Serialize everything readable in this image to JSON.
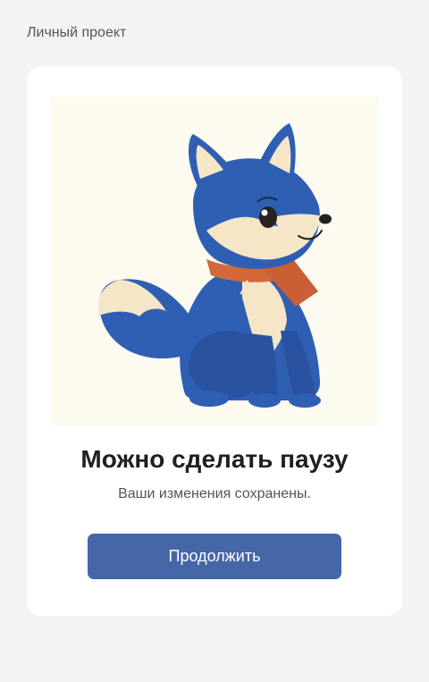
{
  "header": {
    "title": "Личный проект"
  },
  "card": {
    "illustration": {
      "icon": "fox-mascot-illustration"
    },
    "title": "Можно сделать паузу",
    "subtitle": "Ваши изменения сохранены.",
    "button_label": "Продолжить"
  },
  "colors": {
    "page_background": "#f4f3f1",
    "card_background": "#ffffff",
    "illustration_background": "#fdfaf0",
    "accent": "#4567a8",
    "fox_blue": "#2f5fb3",
    "fox_cream": "#f6e6c8",
    "scarf": "#d2693b"
  }
}
